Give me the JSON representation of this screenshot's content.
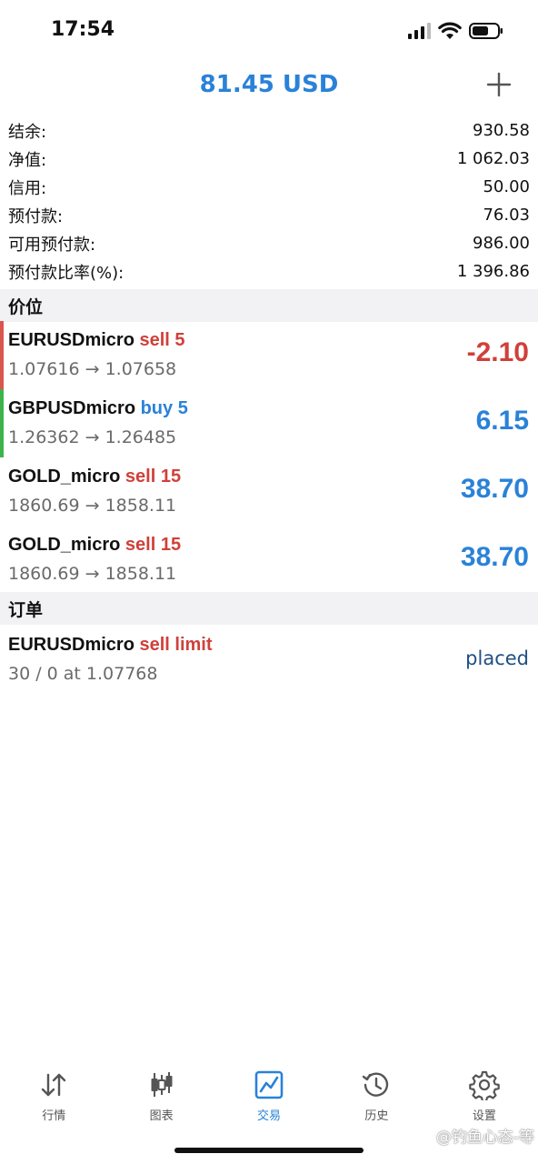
{
  "status_bar": {
    "time": "17:54"
  },
  "header": {
    "title": "81.45 USD"
  },
  "summary": [
    {
      "label": "结余:",
      "value": "930.58"
    },
    {
      "label": "净值:",
      "value": "1 062.03"
    },
    {
      "label": "信用:",
      "value": "50.00"
    },
    {
      "label": "预付款:",
      "value": "76.03"
    },
    {
      "label": "可用预付款:",
      "value": "986.00"
    },
    {
      "label": "预付款比率(%):",
      "value": "1 396.86"
    }
  ],
  "positions_section": {
    "title": "价位"
  },
  "positions": [
    {
      "symbol": "EURUSDmicro",
      "side": "sell 5",
      "prices": "1.07616 → 1.07658",
      "profit": "-2.10",
      "stripe_color": "#d9574f"
    },
    {
      "symbol": "GBPUSDmicro",
      "side": "buy 5",
      "prices": "1.26362 → 1.26485",
      "profit": "6.15",
      "stripe_color": "#3cb44a"
    },
    {
      "symbol": "GOLD_micro",
      "side": "sell 15",
      "prices": "1860.69 → 1858.11",
      "profit": "38.70"
    },
    {
      "symbol": "GOLD_micro",
      "side": "sell 15",
      "prices": "1860.69 → 1858.11",
      "profit": "38.70"
    }
  ],
  "orders_section": {
    "title": "订单"
  },
  "orders": [
    {
      "symbol": "EURUSDmicro",
      "type": "sell limit",
      "detail": "30 / 0 at 1.07768",
      "status": "placed"
    }
  ],
  "tabs": [
    {
      "label": "行情",
      "icon": "quotes-arrows-icon"
    },
    {
      "label": "图表",
      "icon": "candlestick-chart-icon"
    },
    {
      "label": "交易",
      "icon": "trade-chart-icon",
      "active": true
    },
    {
      "label": "历史",
      "icon": "history-clock-icon"
    },
    {
      "label": "设置",
      "icon": "gear-icon"
    }
  ],
  "watermark": "@钓鱼心态-等",
  "colors": {
    "accent": "#2a82d8",
    "sell": "#d0403a",
    "buy": "#2a82d8"
  }
}
